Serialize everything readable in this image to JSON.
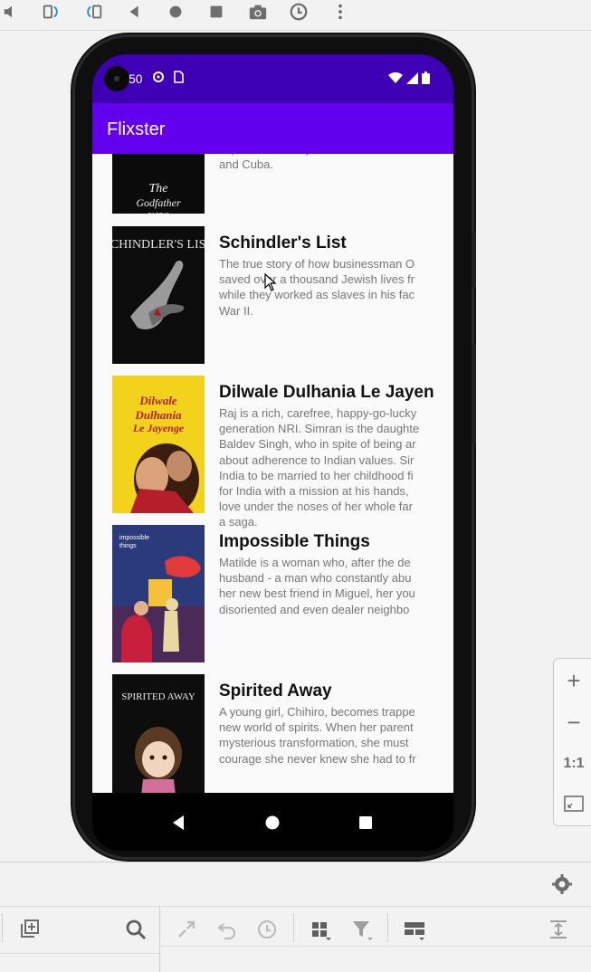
{
  "emulator_toolbar": {
    "items": [
      "volume-icon",
      "rotate-left-icon",
      "rotate-right-icon",
      "back-icon",
      "home-icon",
      "overview-icon",
      "screenshot-icon",
      "snapshot-icon",
      "more-icon"
    ]
  },
  "status_bar": {
    "time": "50",
    "color": "#3f00b5"
  },
  "app_bar": {
    "title": "Flixster",
    "color": "#6200ee"
  },
  "movies": [
    {
      "title": "",
      "overview_lines": [
        "expand the family business into Las V",
        "and Cuba."
      ],
      "poster_text": "The Godfather PART II"
    },
    {
      "title": "Schindler's List",
      "overview_lines": [
        "The true story of how businessman O",
        "saved over a thousand Jewish lives fr",
        "while they worked as slaves in his fac",
        "War II."
      ],
      "poster_text": "SCHINDLER'S LIST"
    },
    {
      "title": "Dilwale Dulhania Le Jayenge",
      "overview_lines": [
        "Raj is a rich, carefree, happy-go-lucky",
        "generation NRI. Simran is the daughte",
        "Baldev Singh, who in spite of being ar",
        "about adherence to Indian values. Sir",
        "India to be married to her childhood fi",
        "for India with a mission at his hands,",
        "love under the noses of her whole far",
        "a saga."
      ],
      "poster_text": "Dilwale Dulhania Le Jayenge"
    },
    {
      "title": "Impossible Things",
      "overview_lines": [
        "Matilde is a woman who, after the de",
        "husband - a man who constantly abu",
        "her new best friend in Miguel, her you",
        "disoriented and even dealer neighbo"
      ],
      "poster_text": "Impossible things"
    },
    {
      "title": "Spirited Away",
      "overview_lines": [
        "A young girl, Chihiro, becomes trappe",
        "new world of spirits. When her parent",
        "mysterious transformation, she must",
        "courage she never knew she had to fr"
      ],
      "poster_text": "SPIRITED AWAY"
    }
  ],
  "zoom_panel": {
    "zoom_in": "+",
    "zoom_out": "−",
    "one_to_one": "1:1"
  }
}
